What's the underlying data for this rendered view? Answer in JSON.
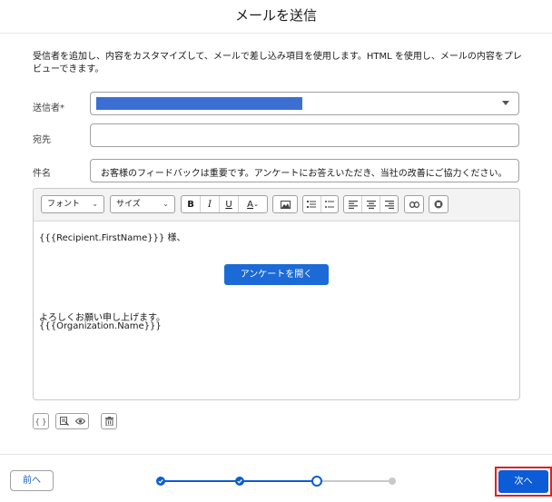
{
  "dialog": {
    "title": "メールを送信"
  },
  "description": "受信者を追加し、内容をカスタマイズして、メールで差し込み項目を使用します。HTML を使用し、メールの内容をプレビューできます。",
  "form": {
    "from_label": "送信者*",
    "to_label": "宛先",
    "to_value": "",
    "subject_label": "件名",
    "subject_value": "お客様のフィードバックは重要です。アンケートにお答えいただき、当社の改善にご協力ください。"
  },
  "toolbar": {
    "font_label": "フォント",
    "size_label": "サイズ",
    "bold": "B",
    "italic": "I",
    "underline": "U",
    "text_color": "A"
  },
  "body": {
    "greeting": "{{{Recipient.FirstName}}} 様、",
    "button_label": "アンケートを開く",
    "closing": "よろしくお願い申し上げます。",
    "signature": "{{{Organization.Name}}}"
  },
  "footer": {
    "back_label": "前へ",
    "next_label": "次へ",
    "steps": [
      {
        "state": "complete"
      },
      {
        "state": "complete"
      },
      {
        "state": "current"
      },
      {
        "state": "incomplete"
      }
    ]
  },
  "colors": {
    "brand": "#0b5cd6",
    "highlight_outline": "#e02020",
    "progress_done": "#0b5cd6",
    "progress_todo": "#c9c9c9"
  },
  "icons": [
    "chevron-down-icon",
    "image-icon",
    "numbered-list-icon",
    "bulleted-list-icon",
    "align-left-icon",
    "align-center-icon",
    "align-right-icon",
    "link-icon",
    "remove-format-icon",
    "merge-field-icon",
    "insert-template-icon",
    "preview-icon",
    "delete-icon",
    "check-icon"
  ]
}
